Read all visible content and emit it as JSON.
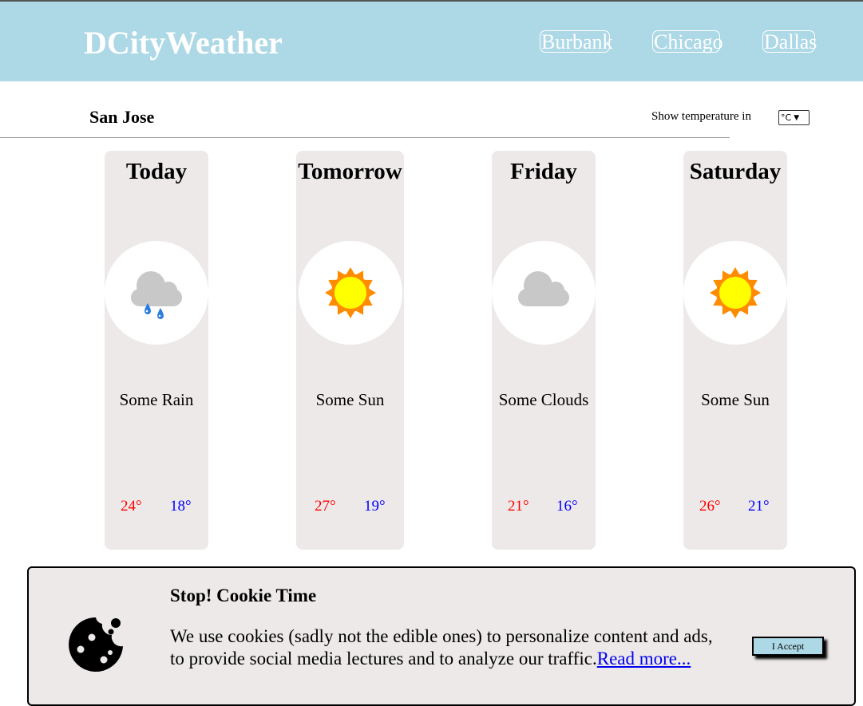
{
  "header": {
    "logo": "DCityWeather",
    "nav": [
      {
        "label": "Burbank"
      },
      {
        "label": "Chicago"
      },
      {
        "label": "Dallas"
      }
    ]
  },
  "location": {
    "city": "San Jose",
    "temp_unit_label": "Show temperature in",
    "temp_unit_selected": "°C"
  },
  "forecast": [
    {
      "day": "Today",
      "condition": "Some Rain",
      "icon": "rain-cloud-icon",
      "high": "24°",
      "low": "18°"
    },
    {
      "day": "Tomorrow",
      "condition": "Some Sun",
      "icon": "sun-icon",
      "high": "27°",
      "low": "19°"
    },
    {
      "day": "Friday",
      "condition": "Some Clouds",
      "icon": "cloud-icon",
      "high": "21°",
      "low": "16°"
    },
    {
      "day": "Saturday",
      "condition": "Some Sun",
      "icon": "sun-icon",
      "high": "26°",
      "low": "21°"
    }
  ],
  "cookie": {
    "title": "Stop! Cookie Time",
    "text": "We use cookies (sadly not the edible ones) to personalize content and ads, to provide social media lectures and to analyze our traffic.",
    "link_label": "Read more...",
    "accept_label": "I Accept",
    "icon": "cookie-icon"
  },
  "colors": {
    "header_bg": "#add8e6",
    "card_bg": "#ede9e9",
    "high_temp": "#ff0000",
    "low_temp": "#0000ff",
    "sun_outer": "#ff8c00",
    "sun_inner": "#ffff00",
    "cloud": "#c8c8c8",
    "rain": "#2a7de1"
  }
}
